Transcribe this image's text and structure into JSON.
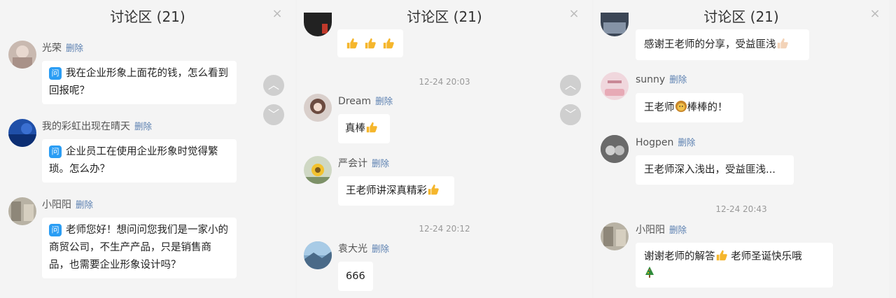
{
  "panel_title": "讨论区 (21)",
  "close_glyph": "×",
  "nav": {
    "up": "︿",
    "down": "﹀"
  },
  "delete_label": "删除",
  "question_badge": "问",
  "panel1": {
    "comments": [
      {
        "name": "光荣",
        "text": "我在企业形象上面花的钱，怎么看到回报呢？"
      },
      {
        "name": "我的彩虹出现在晴天",
        "text": "企业员工在使用企业形象时觉得繁琐。怎么办？"
      },
      {
        "name": "小阳阳",
        "text": "老师您好！想问问您我们是一家小的商贸公司，不生产产品，只是销售商品，也需要企业形象设计吗？"
      }
    ]
  },
  "panel2": {
    "time1": "12-24 20:03",
    "time2": "12-24 20:12",
    "comments": [
      {
        "name": "Dream",
        "text": "真棒"
      },
      {
        "name": "严会计",
        "text": "王老师讲深真精彩"
      },
      {
        "name": "袁大光",
        "text": "666"
      }
    ]
  },
  "panel3": {
    "top_text": "感谢王老师的分享，受益匪浅",
    "time1": "12-24 20:43",
    "comments": [
      {
        "name": "sunny",
        "text_a": "王老师",
        "text_b": "棒棒的！"
      },
      {
        "name": "Hogpen",
        "text": "王老师深入浅出，受益匪浅..."
      },
      {
        "name": "小阳阳",
        "text_a": "谢谢老师的解答",
        "text_b": " 老师圣诞快乐哦"
      }
    ]
  },
  "colors": {
    "accent_blue": "#2a9df4",
    "delete_link": "#5a7fb0",
    "background": "#f4f4f4"
  }
}
